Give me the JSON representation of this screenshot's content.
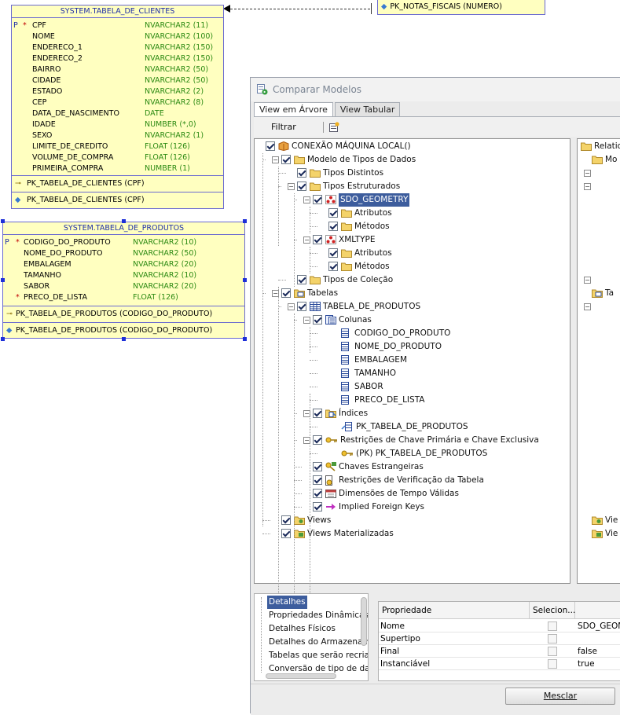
{
  "fk_table": {
    "label": "PK_NOTAS_FISCAIS (NUMERO)"
  },
  "clientes": {
    "title": "SYSTEM.TABELA_DE_CLIENTES",
    "columns": [
      {
        "flag": "P",
        "star": "*",
        "name": "CPF",
        "type": "NVARCHAR2 (11)"
      },
      {
        "flag": "",
        "star": "",
        "name": "NOME",
        "type": "NVARCHAR2 (100)"
      },
      {
        "flag": "",
        "star": "",
        "name": "ENDERECO_1",
        "type": "NVARCHAR2 (150)"
      },
      {
        "flag": "",
        "star": "",
        "name": "ENDERECO_2",
        "type": "NVARCHAR2 (150)"
      },
      {
        "flag": "",
        "star": "",
        "name": "BAIRRO",
        "type": "NVARCHAR2 (50)"
      },
      {
        "flag": "",
        "star": "",
        "name": "CIDADE",
        "type": "NVARCHAR2 (50)"
      },
      {
        "flag": "",
        "star": "",
        "name": "ESTADO",
        "type": "NVARCHAR2 (2)"
      },
      {
        "flag": "",
        "star": "",
        "name": "CEP",
        "type": "NVARCHAR2 (8)"
      },
      {
        "flag": "",
        "star": "",
        "name": "DATA_DE_NASCIMENTO",
        "type": "DATE"
      },
      {
        "flag": "",
        "star": "",
        "name": "IDADE",
        "type": "NUMBER (*,0)"
      },
      {
        "flag": "",
        "star": "",
        "name": "SEXO",
        "type": "NVARCHAR2 (1)"
      },
      {
        "flag": "",
        "star": "",
        "name": "LIMITE_DE_CREDITO",
        "type": "FLOAT (126)"
      },
      {
        "flag": "",
        "star": "",
        "name": "VOLUME_DE_COMPRA",
        "type": "FLOAT (126)"
      },
      {
        "flag": "",
        "star": "",
        "name": "PRIMEIRA_COMPRA",
        "type": "NUMBER (1)"
      }
    ],
    "pk": "PK_TABELA_DE_CLIENTES (CPF)",
    "index": "PK_TABELA_DE_CLIENTES (CPF)"
  },
  "produtos": {
    "title": "SYSTEM.TABELA_DE_PRODUTOS",
    "columns": [
      {
        "flag": "P",
        "star": "*",
        "name": "CODIGO_DO_PRODUTO",
        "type": "NVARCHAR2 (10)"
      },
      {
        "flag": "",
        "star": "",
        "name": "NOME_DO_PRODUTO",
        "type": "NVARCHAR2 (50)"
      },
      {
        "flag": "",
        "star": "",
        "name": "EMBALAGEM",
        "type": "NVARCHAR2 (20)"
      },
      {
        "flag": "",
        "star": "",
        "name": "TAMANHO",
        "type": "NVARCHAR2 (10)"
      },
      {
        "flag": "",
        "star": "",
        "name": "SABOR",
        "type": "NVARCHAR2 (20)"
      },
      {
        "flag": "",
        "star": "*",
        "name": "PRECO_DE_LISTA",
        "type": "FLOAT (126)"
      }
    ],
    "pk": "PK_TABELA_DE_PRODUTOS (CODIGO_DO_PRODUTO)",
    "index": "PK_TABELA_DE_PRODUTOS (CODIGO_DO_PRODUTO)"
  },
  "dialog": {
    "title": "Comparar Modelos",
    "tabs": [
      "View em Árvore",
      "View Tabular"
    ],
    "filter_label": "Filtrar",
    "tree": [
      "CONEXÃO MÁQUINA LOCAL()",
      "Modelo de Tipos de Dados",
      "Tipos Distintos",
      "Tipos Estruturados",
      "SDO_GEOMETRY",
      "Atributos",
      "Métodos",
      "XMLTYPE",
      "Atributos",
      "Métodos",
      "Tipos de Coleção",
      "Tabelas",
      "TABELA_DE_PRODUTOS",
      "Colunas",
      "CODIGO_DO_PRODUTO",
      "NOME_DO_PRODUTO",
      "EMBALAGEM",
      "TAMANHO",
      "SABOR",
      "PRECO_DE_LISTA",
      "Índices",
      "PK_TABELA_DE_PRODUTOS",
      "Restrições de Chave Primária e Chave Exclusiva",
      "(PK) PK_TABELA_DE_PRODUTOS",
      "Chaves Estrangeiras",
      "Restrições de Verificação da Tabela",
      "Dimensões de Tempo Válidas",
      "Implied Foreign Keys",
      "Views",
      "Views Materializadas"
    ],
    "right_tree": [
      "Relatio",
      "Mo",
      "Ta",
      "Vie",
      "Vie"
    ],
    "nav_items": [
      "Detalhes",
      "Propriedades Dinâmicas",
      "Detalhes Físicos",
      "Detalhes do Armazenam",
      "Tabelas que serão recria",
      "Conversão de tipo de da"
    ],
    "props_headers": [
      "Propriedade",
      "Selecion..."
    ],
    "props_rows": [
      {
        "name": "Nome",
        "value": "SDO_GEOM"
      },
      {
        "name": "Supertipo",
        "value": ""
      },
      {
        "name": "Final",
        "value": "false"
      },
      {
        "name": "Instanciável",
        "value": "true"
      }
    ],
    "merge_label": "Mesclar"
  }
}
